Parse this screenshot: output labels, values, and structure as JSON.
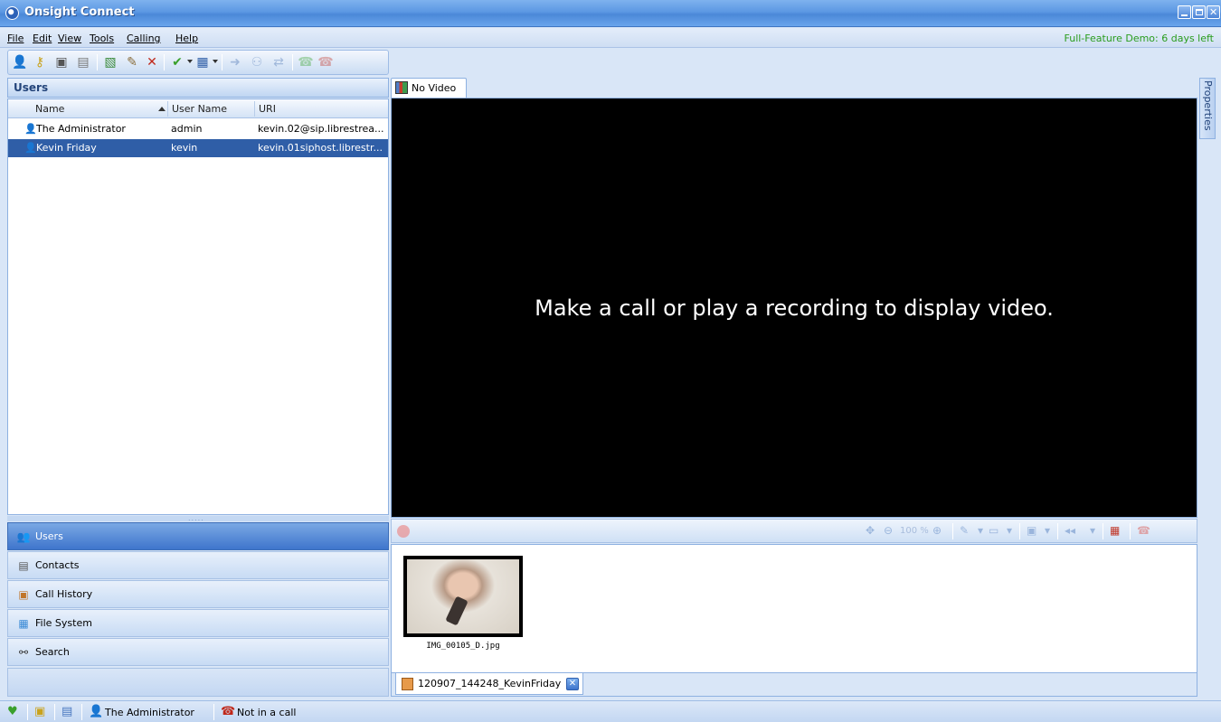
{
  "window": {
    "title": "Onsight Connect",
    "demo_notice": "Full-Feature Demo: 6 days left"
  },
  "menu": {
    "items": [
      "File",
      "Edit",
      "View",
      "Tools",
      "Calling",
      "Help"
    ]
  },
  "toolbar": {
    "icons": [
      "user-icon",
      "key-icon",
      "camera-icon",
      "phonebook-icon",
      "new-document-icon",
      "edit-pencil-icon",
      "delete-x-icon",
      "status-check-icon",
      "media-icon",
      "call-forward-icon",
      "conference-icon",
      "transfer-icon",
      "dial-icon",
      "hangup-icon"
    ]
  },
  "users_panel": {
    "header": "Users",
    "columns": [
      "Name",
      "User Name",
      "URI"
    ],
    "rows": [
      {
        "name": "The Administrator",
        "username": "admin",
        "uri": "kevin.02@sip.librestrea..."
      },
      {
        "name": "Kevin Friday",
        "username": "kevin",
        "uri": "kevin.01siphost.librestr..."
      }
    ],
    "selected_row": 1
  },
  "nav": {
    "items": [
      {
        "label": "Users",
        "icon": "users-icon",
        "active": true
      },
      {
        "label": "Contacts",
        "icon": "contacts-icon",
        "active": false
      },
      {
        "label": "Call History",
        "icon": "call-history-icon",
        "active": false
      },
      {
        "label": "File System",
        "icon": "file-system-icon",
        "active": false
      },
      {
        "label": "Search",
        "icon": "binoculars-icon",
        "active": false
      }
    ]
  },
  "video": {
    "tab_label": "No Video",
    "message": "Make a call or play a recording to display video.",
    "properties_label": "Properties",
    "zoom_label": "100 %"
  },
  "gallery": {
    "items": [
      {
        "filename": "IMG_00105_D.jpg"
      }
    ],
    "file_tab_label": "120907_144248_KevinFriday"
  },
  "status": {
    "current_user": "The Administrator",
    "call_status": "Not in a call"
  },
  "colors": {
    "title_bar": "#5c98e3",
    "selection": "#2f5ea7",
    "demo_text": "#2a9d1d",
    "video_bg": "#000000"
  }
}
